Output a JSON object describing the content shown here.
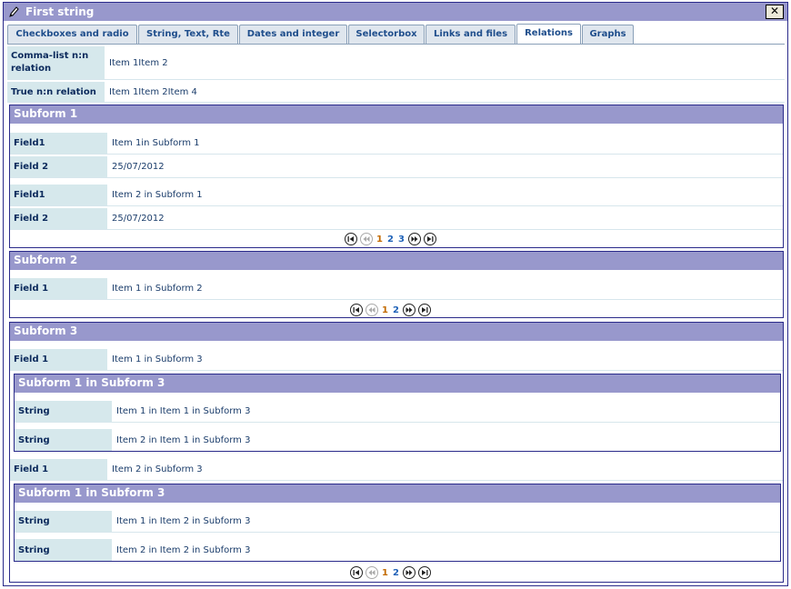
{
  "window": {
    "title": "First string"
  },
  "tabs": [
    {
      "label": "Checkboxes and radio"
    },
    {
      "label": "String, Text, Rte"
    },
    {
      "label": "Dates and integer"
    },
    {
      "label": "Selectorbox"
    },
    {
      "label": "Links and files"
    },
    {
      "label": "Relations",
      "active": true
    },
    {
      "label": "Graphs"
    }
  ],
  "relations": {
    "comma_list": {
      "label_line1": "Comma-list n:n",
      "label_line2": "relation",
      "value": "Item 1Item 2"
    },
    "true_nn": {
      "label": "True n:n relation",
      "value": "Item 1Item 2Item 4"
    }
  },
  "subform1": {
    "title": "Subform 1",
    "items": [
      {
        "field1_label": "Field1",
        "field1_value": "Item 1in Subform 1",
        "field2_label": "Field 2",
        "field2_value": "25/07/2012"
      },
      {
        "field1_label": "Field1",
        "field1_value": "Item 2 in Subform 1",
        "field2_label": "Field 2",
        "field2_value": "25/07/2012"
      }
    ],
    "pager": {
      "pages": [
        "1",
        "2",
        "3"
      ],
      "current": "1"
    }
  },
  "subform2": {
    "title": "Subform 2",
    "items": [
      {
        "field1_label": "Field 1",
        "field1_value": "Item 1 in Subform 2"
      }
    ],
    "pager": {
      "pages": [
        "1",
        "2"
      ],
      "current": "1"
    }
  },
  "subform3": {
    "title": "Subform 3",
    "items": [
      {
        "field1_label": "Field 1",
        "field1_value": "Item 1 in Subform 3",
        "nested": {
          "title": "Subform 1 in Subform 3",
          "rows": [
            {
              "label": "String",
              "value": "Item 1 in Item 1 in Subform 3"
            },
            {
              "label": "String",
              "value": "Item 2 in Item 1 in Subform 3"
            }
          ]
        }
      },
      {
        "field1_label": "Field 1",
        "field1_value": "Item 2 in Subform 3",
        "nested": {
          "title": "Subform 1 in Subform 3",
          "rows": [
            {
              "label": "String",
              "value": "Item 1 in Item 2 in Subform 3"
            },
            {
              "label": "String",
              "value": "Item 2 in Item 2 in Subform 3"
            }
          ]
        }
      }
    ],
    "pager": {
      "pages": [
        "1",
        "2"
      ],
      "current": "1"
    }
  },
  "colors": {
    "header_bg": "#9898cc",
    "label_bg": "#d6e8ec",
    "border": "#2a2a8a",
    "current_page": "#c26a00",
    "page_link": "#1f62b8"
  },
  "icons": {
    "title": "pencil-icon",
    "close": "close-icon",
    "pager_first": "first-page-icon",
    "pager_prev": "prev-page-icon",
    "pager_next": "next-page-icon",
    "pager_last": "last-page-icon"
  }
}
